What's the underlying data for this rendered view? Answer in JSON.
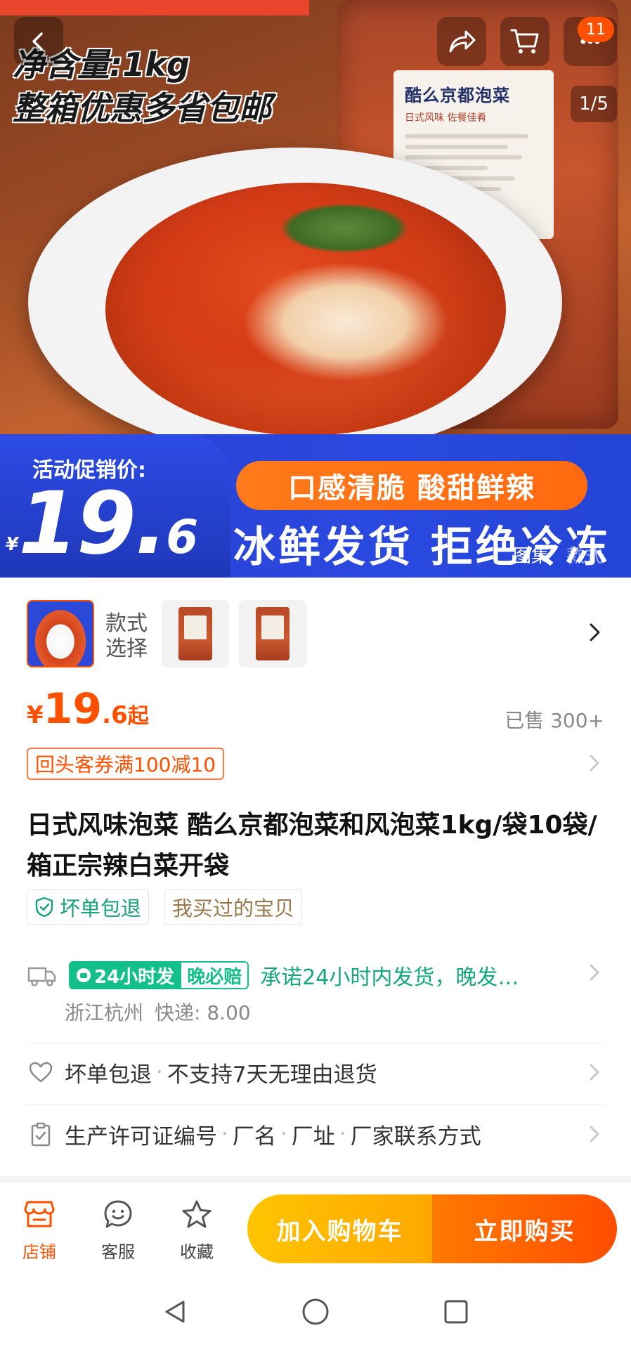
{
  "header": {
    "badge_count": "11",
    "page_indicator": "1/5"
  },
  "hero": {
    "net_weight": "净含量:1kg",
    "box_offer": "整箱优惠多省包邮",
    "package_label_title": "酷么京都泡菜",
    "package_label_sub": "日式风味 佐餐佳肴",
    "promo_label": "活动促销价:",
    "promo_currency": "¥",
    "promo_price_int": "19.",
    "promo_price_dec": "6",
    "tagline": "口感清脆 酸甜鲜辣",
    "slogan": "冰鲜发货 拒绝冷冻",
    "gallery_tab_active": "图集",
    "gallery_tab_inactive": "款式"
  },
  "style_selector": {
    "label": "款式选择"
  },
  "price": {
    "currency": "¥",
    "int": "19",
    "dec": ".6",
    "suffix": "起",
    "sold": "已售 300+"
  },
  "coupon": {
    "text": "回头客券满100减10"
  },
  "product": {
    "title": "日式风味泡菜 酷么京都泡菜和风泡菜1kg/袋10袋/箱正宗辣白菜开袋",
    "tags": [
      "坏单包退",
      "我买过的宝贝"
    ]
  },
  "shipping": {
    "badge_left": "24小时发",
    "badge_right": "晚必赔",
    "description": "承诺24小时内发货，晚发…",
    "origin": "浙江杭州",
    "fee": "快递: 8.00"
  },
  "guarantee": {
    "items": [
      "坏单包退",
      "不支持7天无理由退货"
    ]
  },
  "license": {
    "items": [
      "生产许可证编号",
      "厂名",
      "厂址",
      "厂家联系方式"
    ]
  },
  "bottom_bar": {
    "shop": "店铺",
    "service": "客服",
    "favorite": "收藏",
    "add_to_cart": "加入购物车",
    "buy_now": "立即购买"
  },
  "colors": {
    "accent": "#ff5000",
    "green": "#14c08a",
    "cart_button": "#ffb300",
    "buy_button": "#ff5a00"
  }
}
